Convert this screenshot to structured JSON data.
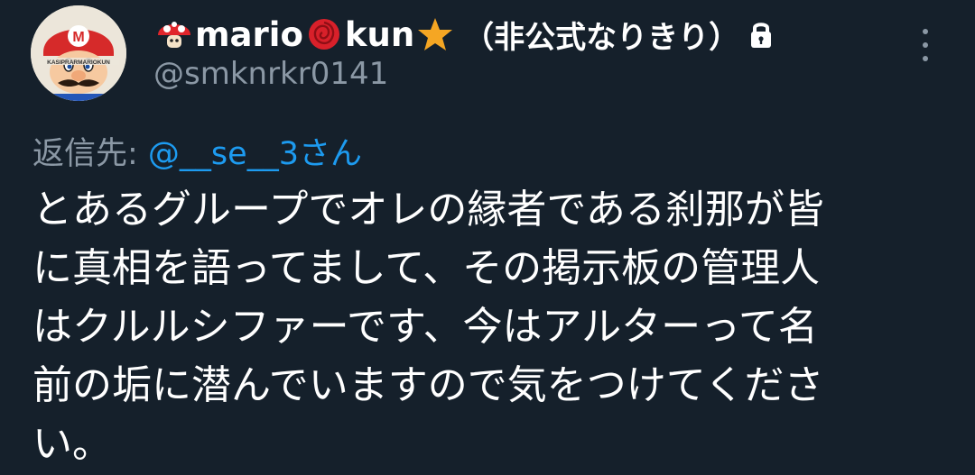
{
  "author": {
    "name_part1": "mario",
    "name_part2": "kun",
    "name_suffix": "（非公式なりきり）",
    "handle": "@smknrkr0141",
    "icons": [
      "mushroom-icon",
      "rose-icon",
      "star-icon",
      "lock-icon"
    ],
    "avatar_caption": "KASIPRARMARIOKUN"
  },
  "menu": {
    "icon": "more-vertical-icon"
  },
  "reply": {
    "prefix": "返信先: ",
    "mention": "@__se__3さん"
  },
  "tweet": {
    "text": "とあるグループでオレの縁者である刹那が皆\nに真相を語ってまして、その掲示板の管理人\nはクルルシファーです、今はアルターって名\n前の垢に潜んでいますので気をつけてくださ\nい。"
  },
  "colors": {
    "background": "#15202b",
    "text": "#ffffff",
    "muted": "#8b98a5",
    "link": "#1d9bf0"
  }
}
